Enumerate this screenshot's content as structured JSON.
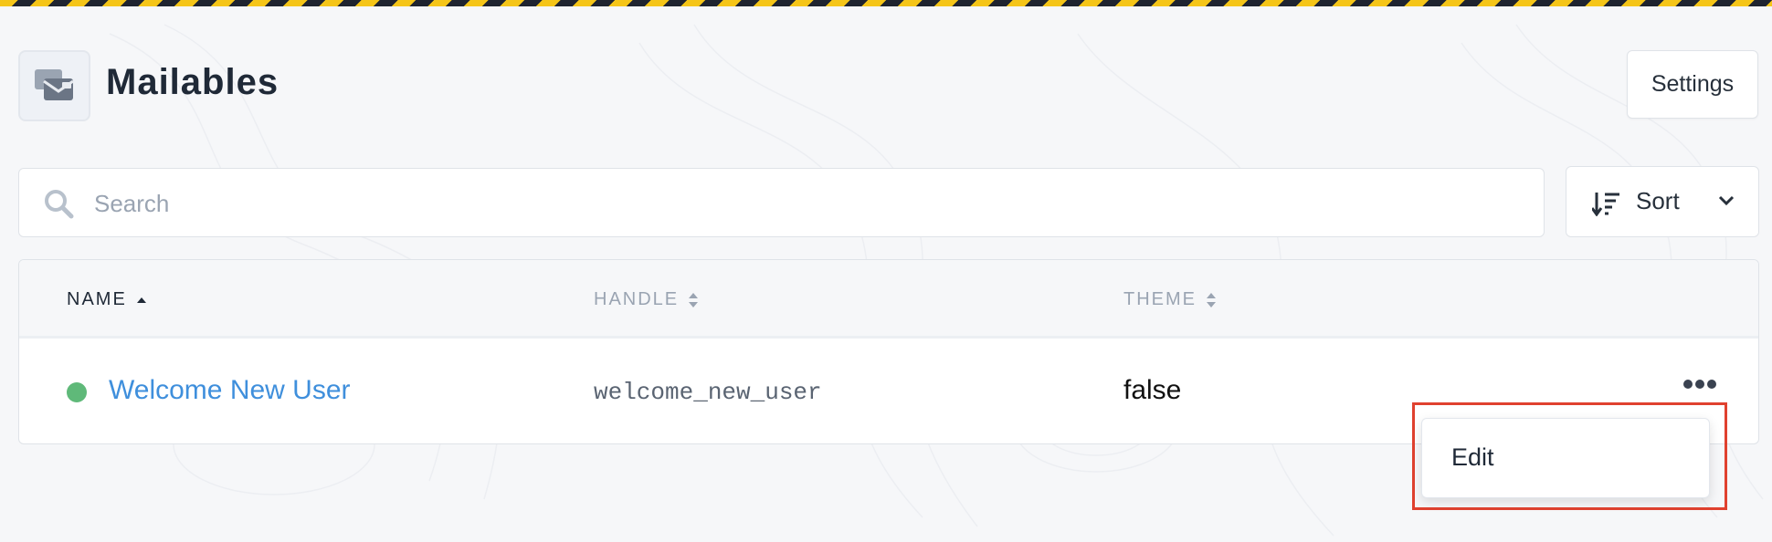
{
  "header": {
    "title": "Mailables",
    "icon": "mailables-icon",
    "settings_label": "Settings"
  },
  "search": {
    "placeholder": "Search",
    "value": ""
  },
  "sort": {
    "label": "Sort",
    "icon": "sort-lines-icon"
  },
  "table": {
    "columns": [
      {
        "label": "NAME",
        "sort": "ascending"
      },
      {
        "label": "HANDLE",
        "sort": "none"
      },
      {
        "label": "THEME",
        "sort": "none"
      }
    ],
    "rows": [
      {
        "status_color": "#5fb979",
        "name": "Welcome New User",
        "handle": "welcome_new_user",
        "theme": "false"
      }
    ]
  },
  "row_menu": {
    "items": [
      {
        "label": "Edit"
      }
    ]
  },
  "colors": {
    "accent_link": "#3f8fdc",
    "highlight_border": "#e0412f",
    "status_active": "#5fb979"
  }
}
